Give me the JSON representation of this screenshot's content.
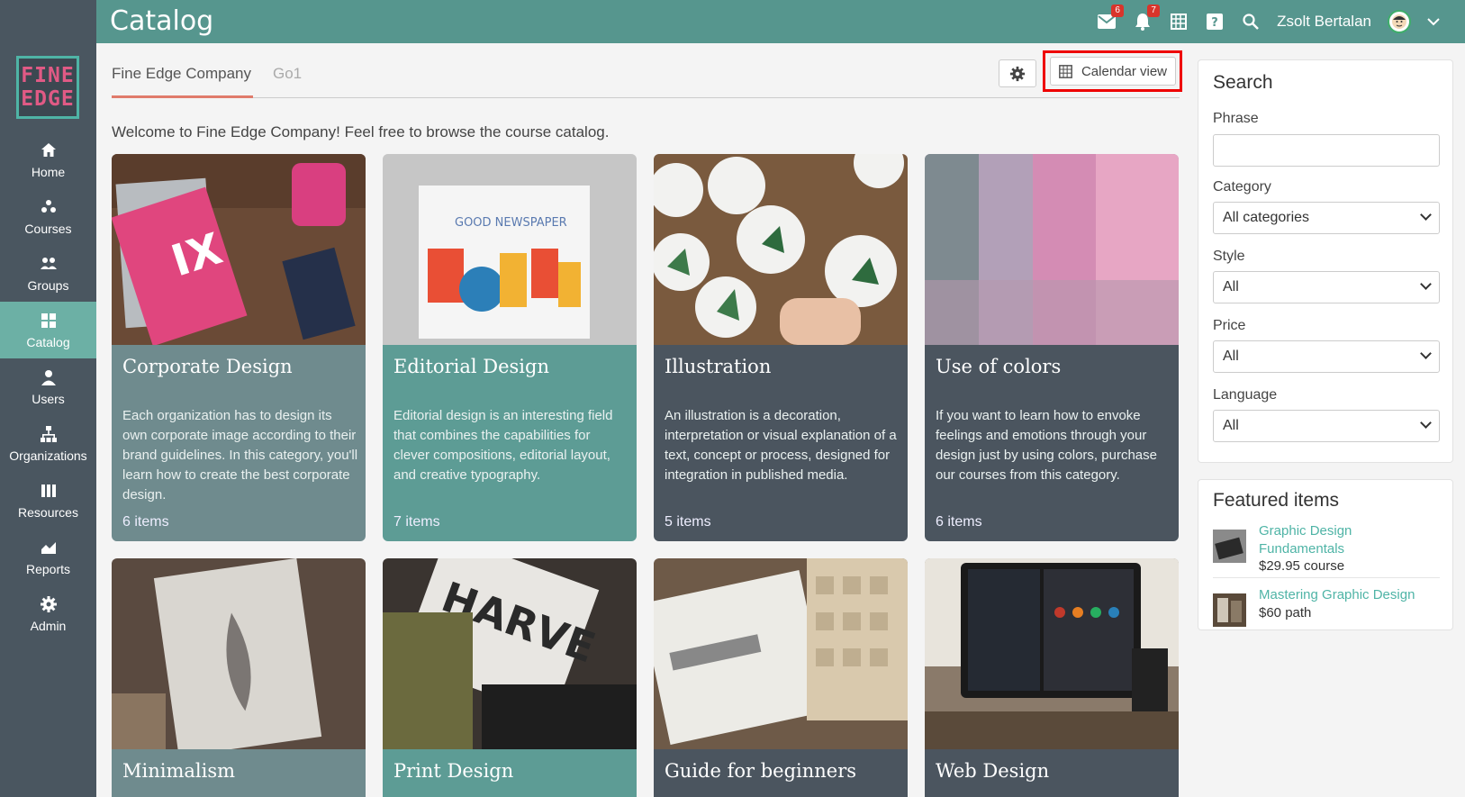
{
  "header": {
    "title": "Catalog",
    "user_name": "Zsolt Bertalan",
    "messages_badge": "6",
    "notifications_badge": "7"
  },
  "logo": {
    "line1": "FINE",
    "line2": "EDGE"
  },
  "sidebar": {
    "items": [
      {
        "label": "Home",
        "icon": "home-icon"
      },
      {
        "label": "Courses",
        "icon": "courses-icon"
      },
      {
        "label": "Groups",
        "icon": "groups-icon"
      },
      {
        "label": "Catalog",
        "icon": "catalog-icon"
      },
      {
        "label": "Users",
        "icon": "user-icon"
      },
      {
        "label": "Organizations",
        "icon": "organizations-icon"
      },
      {
        "label": "Resources",
        "icon": "resources-icon"
      },
      {
        "label": "Reports",
        "icon": "reports-icon"
      },
      {
        "label": "Admin",
        "icon": "gear-icon"
      }
    ]
  },
  "tabs": [
    {
      "label": "Fine Edge Company"
    },
    {
      "label": "Go1"
    }
  ],
  "toolbar": {
    "calendar_view_label": "Calendar view"
  },
  "welcome": "Welcome to Fine Edge Company! Feel free to browse the course catalog.",
  "cards": [
    {
      "title": "Corporate Design",
      "description": "Each organization has to design its own corporate image according to their brand guidelines. In this category, you'll learn how to create the best corporate design.",
      "count": "6 items",
      "color": "#6f8b8e"
    },
    {
      "title": "Editorial Design",
      "description": "Editorial design is an interesting field that combines the capabilities for clever compositions, editorial layout, and creative typography.",
      "count": "7 items",
      "color": "#5d9c95"
    },
    {
      "title": "Illustration",
      "description": "An illustration is a decoration, interpretation or visual explanation of a text, concept or process, designed for integration in published media.",
      "count": "5 items",
      "color": "#4b555f"
    },
    {
      "title": "Use of colors",
      "description": "If you want to learn how to envoke feelings and emotions through your design just by using colors, purchase our courses from this category.",
      "count": "6 items",
      "color": "#4b555f"
    },
    {
      "title": "Minimalism",
      "color": "#6f8b8e"
    },
    {
      "title": "Print Design",
      "color": "#5d9c95"
    },
    {
      "title": "Guide for beginners",
      "color": "#4b555f"
    },
    {
      "title": "Web Design",
      "color": "#4b555f"
    }
  ],
  "search": {
    "title": "Search",
    "phrase_label": "Phrase",
    "phrase_value": "",
    "category_label": "Category",
    "category_value": "All categories",
    "style_label": "Style",
    "style_value": "All",
    "price_label": "Price",
    "price_value": "All",
    "language_label": "Language",
    "language_value": "All"
  },
  "featured": {
    "title": "Featured items",
    "items": [
      {
        "name": "Graphic Design Fundamentals",
        "price": "$29.95 course"
      },
      {
        "name": "Mastering Graphic Design",
        "price": "$60 path"
      }
    ]
  },
  "colors": {
    "header": "#56968e",
    "sidebar": "#4a5660",
    "active": "#6cb0a5",
    "accent": "#4fb4a6"
  }
}
